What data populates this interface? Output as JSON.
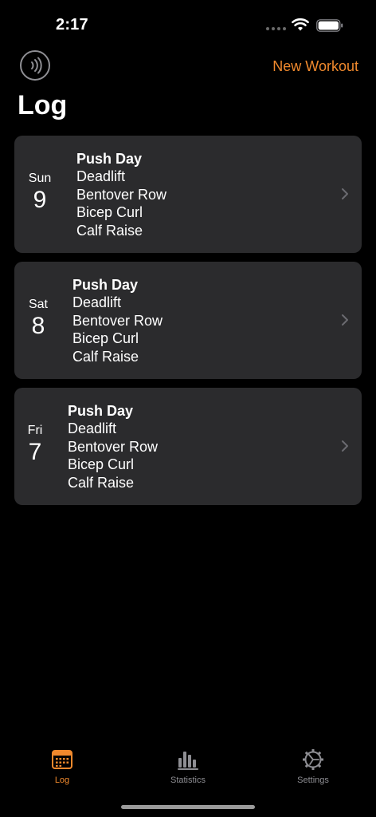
{
  "status_bar": {
    "time": "2:17"
  },
  "nav": {
    "left_icon": "broadcast-icon",
    "new_workout_label": "New Workout",
    "title": "Log"
  },
  "colors": {
    "accent": "#f0892d",
    "card_bg": "#2b2b2d",
    "background": "#000000",
    "inactive_tab": "#8e8e93"
  },
  "workouts": [
    {
      "weekday": "Sun",
      "day": "9",
      "title": "Push Day",
      "exercises": [
        "Deadlift",
        "Bentover Row",
        "Bicep Curl",
        "Calf Raise"
      ]
    },
    {
      "weekday": "Sat",
      "day": "8",
      "title": "Push Day",
      "exercises": [
        "Deadlift",
        "Bentover Row",
        "Bicep Curl",
        "Calf Raise"
      ]
    },
    {
      "weekday": "Fri",
      "day": "7",
      "title": "Push Day",
      "exercises": [
        "Deadlift",
        "Bentover Row",
        "Bicep Curl",
        "Calf Raise"
      ]
    }
  ],
  "tabs": [
    {
      "label": "Log",
      "icon": "calendar-icon",
      "active": true
    },
    {
      "label": "Statistics",
      "icon": "bar-chart-icon",
      "active": false
    },
    {
      "label": "Settings",
      "icon": "gear-icon",
      "active": false
    }
  ]
}
